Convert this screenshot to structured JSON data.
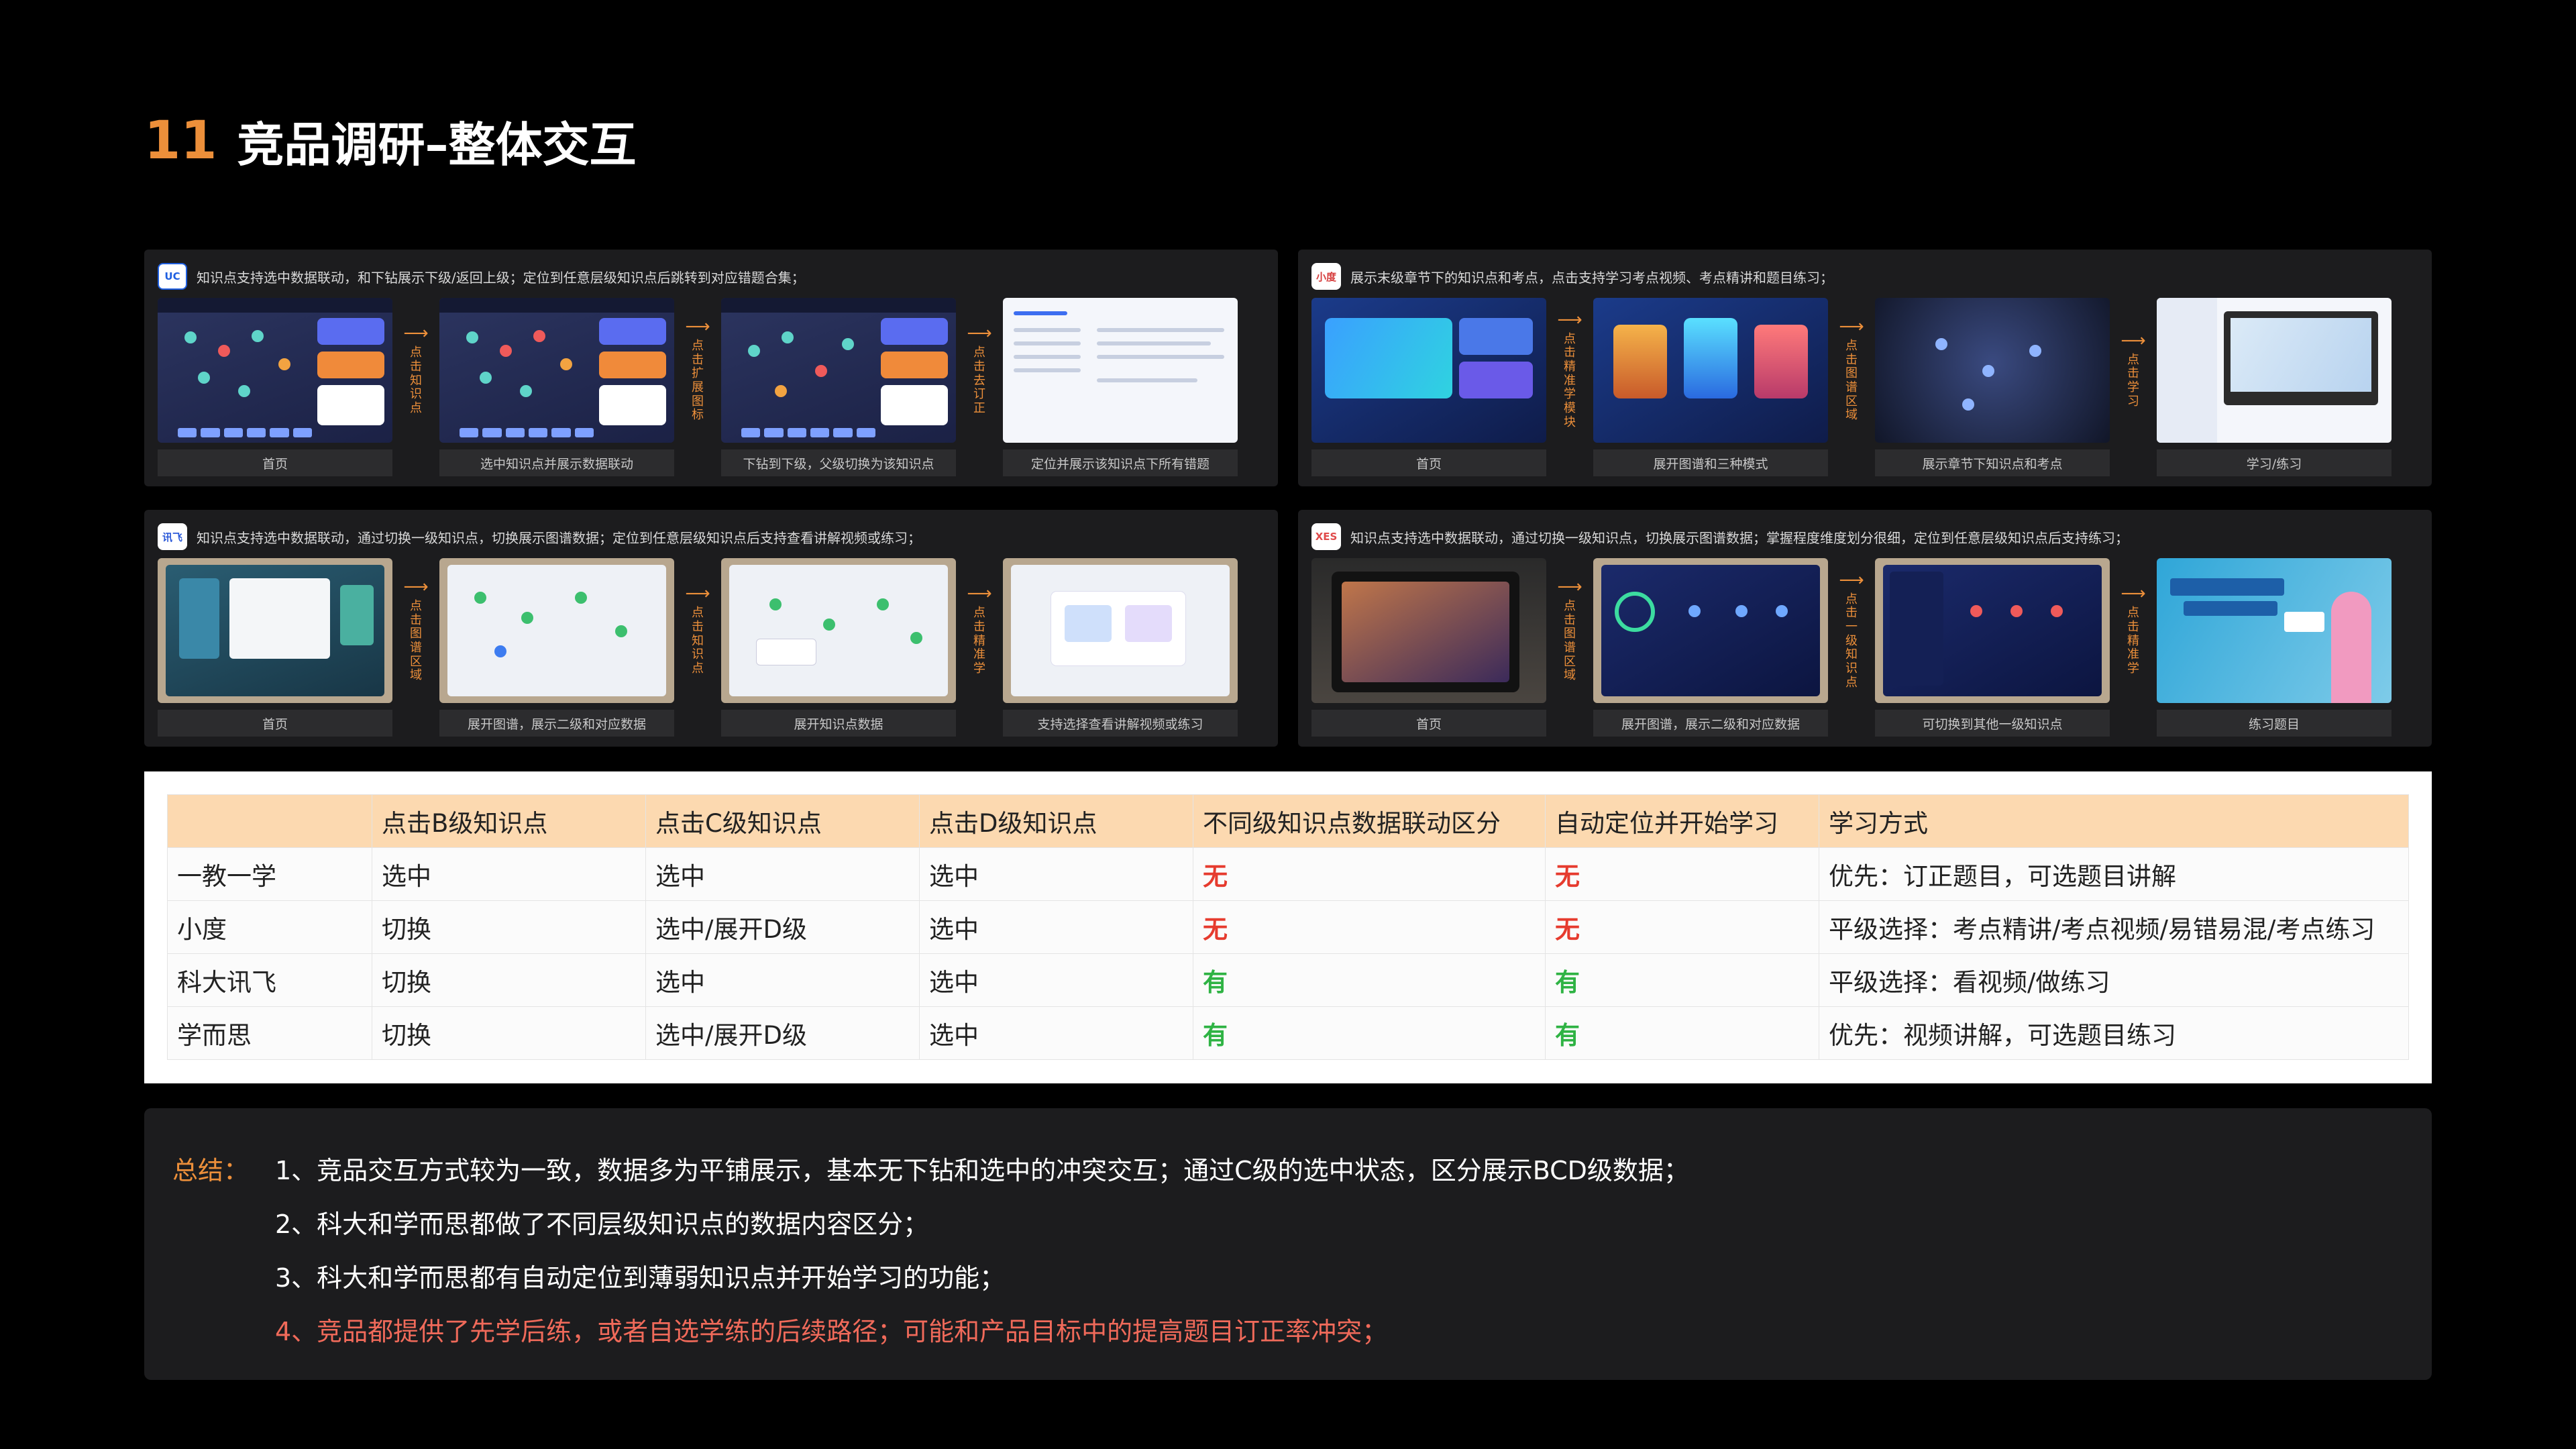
{
  "header": {
    "number": "11",
    "title": "竞品调研–整体交互"
  },
  "panels": [
    {
      "logo": "UC",
      "desc": "知识点支持选中数据联动，和下钻展示下级/返回上级；定位到任意层级知识点后跳转到对应错题合集；",
      "captions": [
        "首页",
        "选中知识点并展示数据联动",
        "下钻到下级，父级切换为该知识点",
        "定位并展示该知识点下所有错题"
      ],
      "arrows": [
        "点击知识点",
        "点击扩展图标",
        "点击去订正"
      ]
    },
    {
      "logo": "小度",
      "desc": "展示末级章节下的知识点和考点，点击支持学习考点视频、考点精讲和题目练习；",
      "captions": [
        "首页",
        "展开图谱和三种模式",
        "展示章节下知识点和考点",
        "学习/练习"
      ],
      "arrows": [
        "点击精准学模块",
        "点击图谱区域",
        "点击学习"
      ]
    },
    {
      "logo": "讯飞",
      "desc": "知识点支持选中数据联动，通过切换一级知识点，切换展示图谱数据；定位到任意层级知识点后支持查看讲解视频或练习；",
      "captions": [
        "首页",
        "展开图谱，展示二级和对应数据",
        "展开知识点数据",
        "支持选择查看讲解视频或练习"
      ],
      "arrows": [
        "点击图谱区域",
        "点击知识点",
        "点击精准学"
      ]
    },
    {
      "logo": "XES",
      "desc": "知识点支持选中数据联动，通过切换一级知识点，切换展示图谱数据；掌握程度维度划分很细，定位到任意层级知识点后支持练习；",
      "captions": [
        "首页",
        "展开图谱，展示二级和对应数据",
        "可切换到其他一级知识点",
        "练习题目"
      ],
      "arrows": [
        "点击图谱区域",
        "点击一级知识点",
        "点击精准学"
      ]
    }
  ],
  "table": {
    "headers": [
      "",
      "点击B级知识点",
      "点击C级知识点",
      "点击D级知识点",
      "不同级知识点数据联动区分",
      "自动定位并开始学习",
      "学习方式"
    ],
    "rows": [
      [
        "一教一学",
        "选中",
        "选中",
        "选中",
        "无",
        "无",
        "优先：订正题目，可选题目讲解"
      ],
      [
        "小度",
        "切换",
        "选中/展开D级",
        "选中",
        "无",
        "无",
        "平级选择：考点精讲/考点视频/易错易混/考点练习"
      ],
      [
        "科大讯飞",
        "切换",
        "选中",
        "选中",
        "有",
        "有",
        "平级选择：看视频/做练习"
      ],
      [
        "学而思",
        "切换",
        "选中/展开D级",
        "选中",
        "有",
        "有",
        "优先：视频讲解，可选题目练习"
      ]
    ],
    "colors": {
      "no": "#e63b2e",
      "yes": "#2fb344",
      "header_bg": "#fcd9b0"
    }
  },
  "summary": {
    "label": "总结：",
    "lines": [
      "1、竞品交互方式较为一致，数据多为平铺展示，基本无下钻和选中的冲突交互；通过C级的选中状态，区分展示BCD级数据；",
      "2、科大和学而思都做了不同层级知识点的数据内容区分；",
      "3、科大和学而思都有自动定位到薄弱知识点并开始学习的功能；",
      "4、竞品都提供了先学后练，或者自选学练的后续路径；可能和产品目标中的提高题目订正率冲突；"
    ]
  },
  "accent": "#ec8f3a"
}
